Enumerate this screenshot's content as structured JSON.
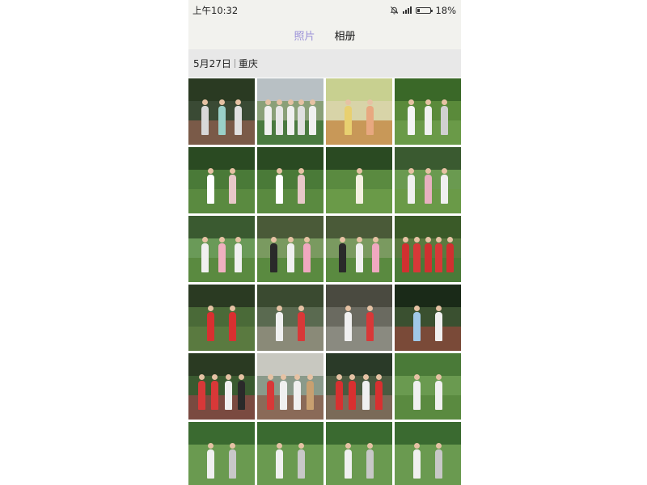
{
  "status_bar": {
    "time": "上午10:32",
    "battery": "18%",
    "battery_level": 0.18
  },
  "tabs": [
    {
      "label": "照片",
      "active": true
    },
    {
      "label": "相册",
      "active": false
    }
  ],
  "section": {
    "date": "5月27日",
    "location": "重庆"
  },
  "photos": [
    {
      "bg": "#3a4a34",
      "tree": "#2a3a22",
      "ground": "#7a5a48",
      "shirts": [
        "#d8d8d8",
        "#9ad0c8",
        "#e0e0e0"
      ]
    },
    {
      "bg": "#8aa078",
      "tree": "#b8c0c4",
      "ground": "#4a7a40",
      "shirts": [
        "#f0f0f0",
        "#e8e8e8",
        "#f0f0f0",
        "#e0e0e0",
        "#f0f0f0"
      ]
    },
    {
      "bg": "#d8d4a8",
      "tree": "#c8d090",
      "ground": "#c89858",
      "shirts": [
        "#e8d070",
        "#e8a880"
      ]
    },
    {
      "bg": "#5a8a3a",
      "tree": "#3a6828",
      "ground": "#6a9a48",
      "shirts": [
        "#f4f4f4",
        "#f0f0f0",
        "#d0d0d0"
      ]
    },
    {
      "bg": "#4a7a38",
      "tree": "#2a4a22",
      "ground": "#5a8a40",
      "shirts": [
        "#ffffff",
        "#e8c8c8"
      ]
    },
    {
      "bg": "#4a7a38",
      "tree": "#2a4a22",
      "ground": "#5a8a40",
      "shirts": [
        "#ffffff",
        "#e8c8c8"
      ]
    },
    {
      "bg": "#5a8a40",
      "tree": "#2a4a22",
      "ground": "#6a9a48",
      "shirts": [
        "#f4f0e0"
      ]
    },
    {
      "bg": "#6a9a50",
      "tree": "#3a5a30",
      "ground": "#6a9a48",
      "shirts": [
        "#f0f0f0",
        "#e8b0c0",
        "#f0f0f0"
      ]
    },
    {
      "bg": "#6a9a58",
      "tree": "#3a5a30",
      "ground": "#5a8a40",
      "shirts": [
        "#f0f0f0",
        "#f0b0c0",
        "#f0f0f0"
      ]
    },
    {
      "bg": "#7a9a60",
      "tree": "#4a5a38",
      "ground": "#5a8a40",
      "shirts": [
        "#2a2a2a",
        "#f0f0f0",
        "#f0a8c0"
      ]
    },
    {
      "bg": "#7a9a60",
      "tree": "#4a5a38",
      "ground": "#5a8a40",
      "shirts": [
        "#2a2a2a",
        "#f0f0f0",
        "#f0a8c0"
      ]
    },
    {
      "bg": "#5a7a40",
      "tree": "#3a5a28",
      "ground": "#4a7a38",
      "shirts": [
        "#d03030",
        "#d83838",
        "#d03030",
        "#d83838",
        "#d03030"
      ]
    },
    {
      "bg": "#4a6a38",
      "tree": "#2a3a22",
      "ground": "#5a7a40",
      "shirts": [
        "#d83030",
        "#d83030"
      ]
    },
    {
      "bg": "#5a6a50",
      "tree": "#3a4a30",
      "ground": "#8a8a78",
      "shirts": [
        "#f0f0f0",
        "#d83838"
      ]
    },
    {
      "bg": "#6a6a60",
      "tree": "#4a4a40",
      "ground": "#8a8a80",
      "shirts": [
        "#f0f0f0",
        "#d83838"
      ]
    },
    {
      "bg": "#3a5030",
      "tree": "#1a2a18",
      "ground": "#7a4a38",
      "shirts": [
        "#a0c8e8",
        "#f0f0f0"
      ]
    },
    {
      "bg": "#3a5a30",
      "tree": "#2a3a22",
      "ground": "#7a4a40",
      "shirts": [
        "#d83838",
        "#d83838",
        "#f0f0f0",
        "#2a2a2a"
      ]
    },
    {
      "bg": "#8a9a8a",
      "tree": "#c8c8c0",
      "ground": "#8a6a58",
      "shirts": [
        "#d83838",
        "#f0f0f0",
        "#f0f0f0",
        "#c8a070"
      ]
    },
    {
      "bg": "#4a5a40",
      "tree": "#2a3a28",
      "ground": "#7a6a58",
      "shirts": [
        "#d83030",
        "#d83030",
        "#f0f0f0",
        "#d83030"
      ]
    },
    {
      "bg": "#6a9a50",
      "tree": "#4a7a38",
      "ground": "#5a8a40",
      "shirts": [
        "#f0f0f0",
        "#f0f0f0"
      ]
    },
    {
      "bg": "#6a9a50",
      "tree": "#3a6a30",
      "ground": "#6a9a50",
      "shirts": [
        "#f0f0f0",
        "#c8c8c8"
      ]
    },
    {
      "bg": "#6a9a50",
      "tree": "#3a6a30",
      "ground": "#6a9a50",
      "shirts": [
        "#f0f0f0",
        "#c8c8c8"
      ]
    },
    {
      "bg": "#6a9a50",
      "tree": "#3a6a30",
      "ground": "#6a9a50",
      "shirts": [
        "#f0f0f0",
        "#c8c8c8"
      ]
    },
    {
      "bg": "#6a9a50",
      "tree": "#3a6a30",
      "ground": "#6a9a50",
      "shirts": [
        "#f0f0f0",
        "#c8c8c8"
      ]
    }
  ]
}
